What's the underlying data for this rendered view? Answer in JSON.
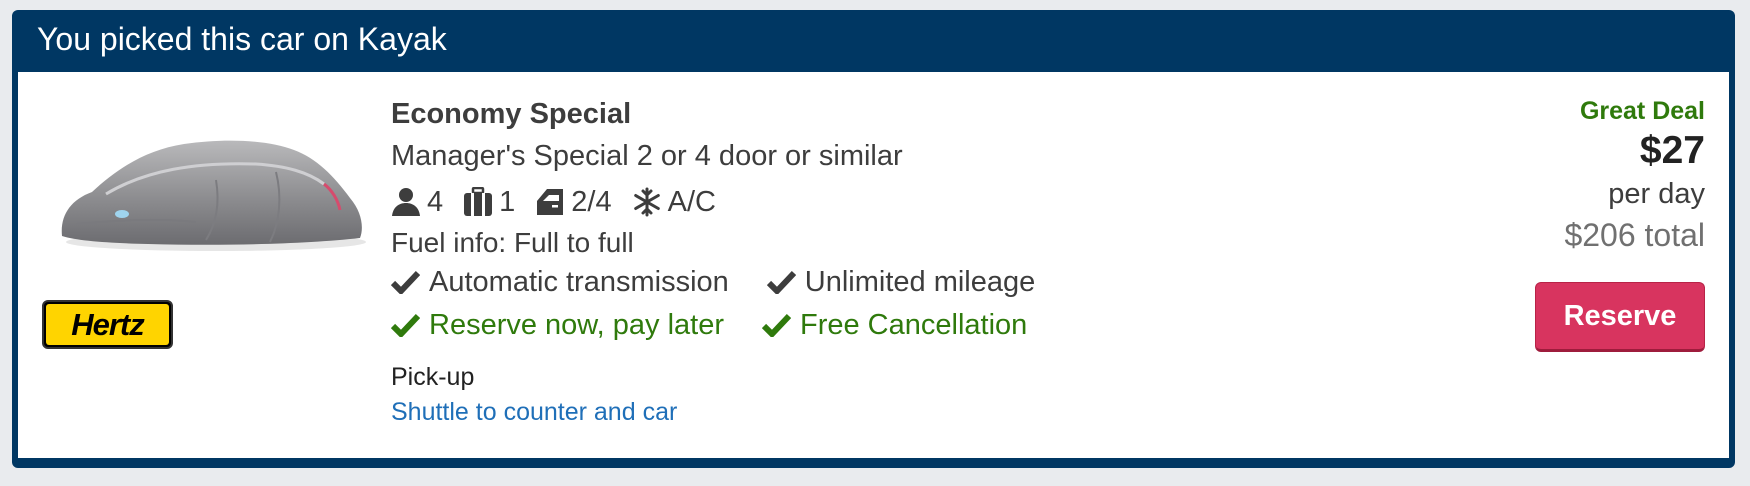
{
  "header": {
    "title": "You picked this car on Kayak"
  },
  "car": {
    "image_icon": "covered-car-image",
    "brand": "Hertz",
    "class_name": "Economy Special",
    "model": "Manager's Special 2 or 4 door or similar",
    "features": {
      "passengers": "4",
      "bags": "1",
      "doors": "2/4",
      "ac": "A/C"
    },
    "fuel_info": "Fuel info: Full to full",
    "amenities": [
      "Automatic transmission",
      "Unlimited mileage"
    ],
    "policies": [
      "Reserve now, pay later",
      "Free Cancellation"
    ],
    "pickup_label": "Pick-up",
    "pickup_value": "Shuttle to counter and car"
  },
  "pricing": {
    "deal_label": "Great Deal",
    "price": "$27",
    "per_day": "per day",
    "total": "$206 total",
    "reserve_label": "Reserve"
  },
  "colors": {
    "header_bg": "#003763",
    "deal_green": "#2f7a0c",
    "reserve_bg": "#d8345f",
    "link_blue": "#1f6fb8",
    "brand_yellow": "#ffd400"
  }
}
